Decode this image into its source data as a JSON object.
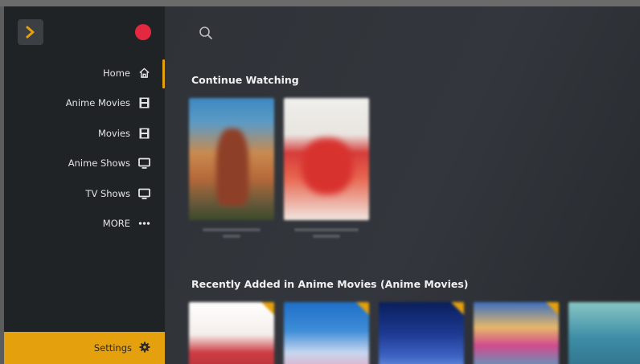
{
  "sidebar": {
    "items": [
      {
        "label": "Home",
        "icon": "home-icon"
      },
      {
        "label": "Anime Movies",
        "icon": "film-icon"
      },
      {
        "label": "Movies",
        "icon": "film-icon"
      },
      {
        "label": "Anime Shows",
        "icon": "tv-icon"
      },
      {
        "label": "TV Shows",
        "icon": "tv-icon"
      },
      {
        "label": "MORE",
        "icon": "ellipsis-icon"
      }
    ],
    "settings_label": "Settings"
  },
  "main": {
    "continue_watching_title": "Continue Watching",
    "recently_added_title": "Recently Added in Anime Movies (Anime Movies)"
  },
  "colors": {
    "accent": "#e5a00d",
    "record_dot": "#e4283f",
    "sidebar_bg": "#202326",
    "main_bg": "#2f3338"
  }
}
